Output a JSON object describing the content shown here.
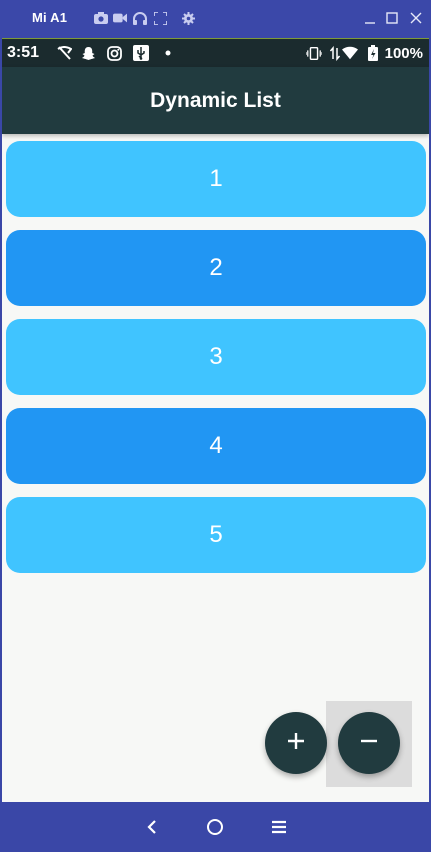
{
  "window": {
    "title": "Mi A1",
    "icons": [
      "camera-icon",
      "video-icon",
      "headphones-icon",
      "fullscreen-icon",
      "settings-icon"
    ],
    "controls": [
      "minimize-icon",
      "maximize-icon",
      "close-icon"
    ]
  },
  "status_bar": {
    "time": "3:51",
    "battery_percent": "100%",
    "left_icons": [
      "signal-off-icon",
      "snapchat-icon",
      "instagram-icon",
      "usb-icon",
      "dot-icon"
    ],
    "right_icons": [
      "vibrate-icon",
      "data-arrows-icon",
      "wifi-icon",
      "battery-icon"
    ]
  },
  "app_bar": {
    "title": "Dynamic List"
  },
  "list": {
    "items": [
      {
        "label": "1",
        "color": "#40c4ff"
      },
      {
        "label": "2",
        "color": "#2196f3"
      },
      {
        "label": "3",
        "color": "#40c4ff"
      },
      {
        "label": "4",
        "color": "#2196f3"
      },
      {
        "label": "5",
        "color": "#40c4ff"
      }
    ]
  },
  "fabs": {
    "add_icon": "plus-icon",
    "remove_icon": "minus-icon",
    "color": "#213b3f"
  },
  "nav_bar": {
    "icons": [
      "back-icon",
      "home-icon",
      "recents-icon"
    ]
  }
}
